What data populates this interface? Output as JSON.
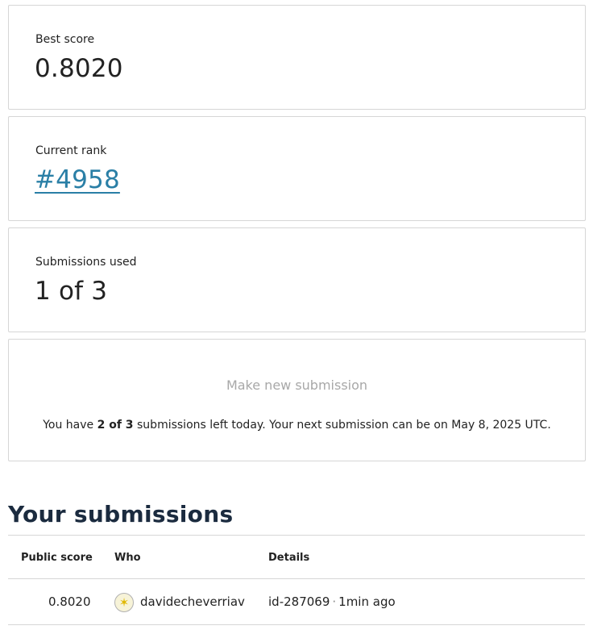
{
  "stats": {
    "best_score": {
      "label": "Best score",
      "value": "0.8020"
    },
    "current_rank": {
      "label": "Current rank",
      "value": "#4958"
    },
    "submissions_used": {
      "label": "Submissions used",
      "value": "1 of 3"
    }
  },
  "submit_panel": {
    "button_label": "Make new submission",
    "remaining_prefix": "You have ",
    "remaining_count": "2 of 3",
    "remaining_middle": " submissions left today. Your next submission can be on ",
    "next_date": "May 8, 2025 UTC",
    "remaining_suffix": "."
  },
  "submissions": {
    "title": "Your submissions",
    "columns": [
      "Public score",
      "Who",
      "Details"
    ],
    "rows": [
      {
        "score": "0.8020",
        "who": "davidecheverriav",
        "id": "id-287069",
        "separator": "·",
        "time": "1min ago",
        "avatar_icon": "sparkle-icon"
      }
    ]
  },
  "colors": {
    "link": "#2a7fa6",
    "title": "#1b2b3f",
    "border": "#d6d6d6",
    "muted": "#a8a8a8"
  }
}
